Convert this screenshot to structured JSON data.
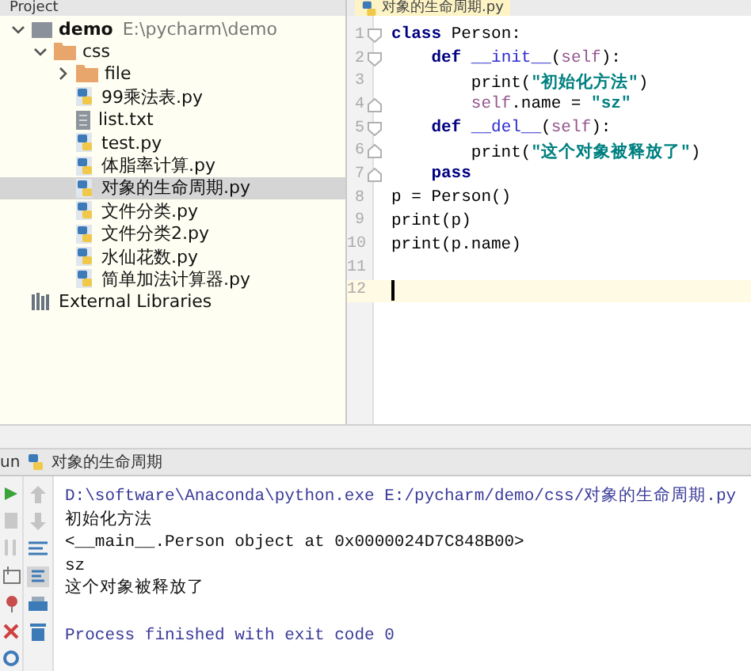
{
  "project_panel": {
    "title": "Project",
    "tree": [
      {
        "label": "demo",
        "path": "E:\\pycharm\\demo",
        "kind": "project",
        "expanded": true,
        "selected": false,
        "children": [
          {
            "label": "css",
            "kind": "folder",
            "expanded": true,
            "selected": false,
            "children": [
              {
                "label": "file",
                "kind": "folder",
                "expanded": false,
                "selected": false
              },
              {
                "label": "99乘法表.py",
                "kind": "python",
                "selected": false
              },
              {
                "label": "list.txt",
                "kind": "text",
                "selected": false
              },
              {
                "label": "test.py",
                "kind": "python",
                "selected": false
              },
              {
                "label": "体脂率计算.py",
                "kind": "python",
                "selected": false
              },
              {
                "label": "对象的生命周期.py",
                "kind": "python",
                "selected": true
              },
              {
                "label": "文件分类.py",
                "kind": "python",
                "selected": false
              },
              {
                "label": "文件分类2.py",
                "kind": "python",
                "selected": false
              },
              {
                "label": "水仙花数.py",
                "kind": "python",
                "selected": false
              },
              {
                "label": "简单加法计算器.py",
                "kind": "python",
                "selected": false
              }
            ]
          }
        ]
      },
      {
        "label": "External Libraries",
        "kind": "libraries",
        "selected": false
      }
    ]
  },
  "editor": {
    "tab": {
      "label": "对象的生命周期.py",
      "selected": true
    },
    "lines": [
      {
        "number": "1",
        "fold_start": true,
        "fold_end": false,
        "current": false,
        "tokens": [
          {
            "text": "class",
            "kind": "keyword"
          },
          {
            "text": " Person:",
            "kind": "plain"
          }
        ]
      },
      {
        "number": "2",
        "fold_start": true,
        "fold_end": false,
        "current": false,
        "tokens": [
          {
            "text": "    def ",
            "kind": "keyword"
          },
          {
            "text": "__init__",
            "kind": "magic"
          },
          {
            "text": "(",
            "kind": "plain"
          },
          {
            "text": "self",
            "kind": "self"
          },
          {
            "text": "):",
            "kind": "plain"
          }
        ]
      },
      {
        "number": "3",
        "fold_start": false,
        "fold_end": false,
        "current": false,
        "tokens": [
          {
            "text": "        print(",
            "kind": "plain"
          },
          {
            "text": "\"初始化方法\"",
            "kind": "string"
          },
          {
            "text": ")",
            "kind": "plain"
          }
        ]
      },
      {
        "number": "4",
        "fold_start": false,
        "fold_end": true,
        "current": false,
        "tokens": [
          {
            "text": "        self",
            "kind": "self"
          },
          {
            "text": ".name = ",
            "kind": "plain"
          },
          {
            "text": "\"sz\"",
            "kind": "string"
          }
        ]
      },
      {
        "number": "5",
        "fold_start": true,
        "fold_end": false,
        "current": false,
        "tokens": [
          {
            "text": "    def ",
            "kind": "keyword"
          },
          {
            "text": "__del__",
            "kind": "magic"
          },
          {
            "text": "(",
            "kind": "plain"
          },
          {
            "text": "self",
            "kind": "self"
          },
          {
            "text": "):",
            "kind": "plain"
          }
        ]
      },
      {
        "number": "6",
        "fold_start": false,
        "fold_end": true,
        "current": false,
        "tokens": [
          {
            "text": "        print(",
            "kind": "plain"
          },
          {
            "text": "\"这个对象被释放了\"",
            "kind": "string"
          },
          {
            "text": ")",
            "kind": "plain"
          }
        ]
      },
      {
        "number": "7",
        "fold_start": false,
        "fold_end": true,
        "current": false,
        "tokens": [
          {
            "text": "    pass",
            "kind": "keyword"
          }
        ]
      },
      {
        "number": "8",
        "fold_start": false,
        "fold_end": false,
        "current": false,
        "tokens": [
          {
            "text": "p = Person()",
            "kind": "plain"
          }
        ]
      },
      {
        "number": "9",
        "fold_start": false,
        "fold_end": false,
        "current": false,
        "tokens": [
          {
            "text": "print(p)",
            "kind": "plain"
          }
        ]
      },
      {
        "number": "10",
        "fold_start": false,
        "fold_end": false,
        "current": false,
        "tokens": [
          {
            "text": "print(p.name)",
            "kind": "plain"
          }
        ]
      },
      {
        "number": "11",
        "fold_start": false,
        "fold_end": false,
        "current": false
      },
      {
        "number": "12",
        "fold_start": false,
        "fold_end": false,
        "current": true
      }
    ]
  },
  "run_panel": {
    "label": "un",
    "config": "对象的生命周期",
    "output": [
      {
        "text": "D:\\software\\Anaconda\\python.exe E:/pycharm/demo/css/对象的生命周期.py",
        "kind": "command"
      },
      {
        "text": "初始化方法",
        "kind": "stdout"
      },
      {
        "text": "<__main__.Person object at 0x0000024D7C848B00>",
        "kind": "stdout"
      },
      {
        "text": "sz",
        "kind": "stdout"
      },
      {
        "text": "这个对象被释放了",
        "kind": "stdout"
      },
      {
        "text": "Process finished with exit code 0",
        "kind": "exit"
      }
    ]
  }
}
